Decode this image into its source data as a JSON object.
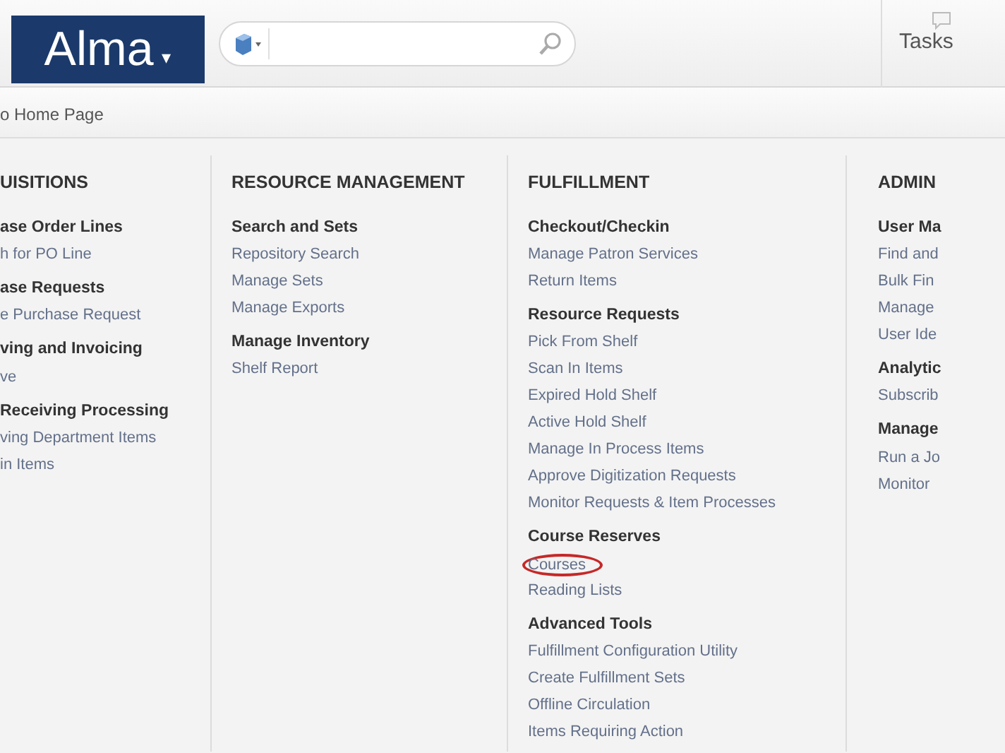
{
  "header": {
    "logo": "Alma",
    "logo_caret": "▾",
    "tasks": "Tasks"
  },
  "breadcrumb": "o Home Page",
  "columns": [
    {
      "title": "UISITIONS",
      "groups": [
        {
          "heading": "ase Order Lines",
          "items": [
            {
              "label": "h for PO Line",
              "highlighted": false
            }
          ]
        },
        {
          "heading": "ase Requests",
          "items": [
            {
              "label": "e Purchase Request",
              "highlighted": false
            }
          ]
        },
        {
          "heading": "ving and Invoicing",
          "items": [
            {
              "label": "ve",
              "highlighted": false
            }
          ]
        },
        {
          "heading": "Receiving Processing",
          "items": [
            {
              "label": "ving Department Items",
              "highlighted": false
            },
            {
              "label": "in Items",
              "highlighted": false
            }
          ]
        }
      ]
    },
    {
      "title": "RESOURCE MANAGEMENT",
      "groups": [
        {
          "heading": "Search and Sets",
          "items": [
            {
              "label": "Repository Search",
              "highlighted": false
            },
            {
              "label": "Manage Sets",
              "highlighted": false
            },
            {
              "label": "Manage Exports",
              "highlighted": false
            }
          ]
        },
        {
          "heading": "Manage Inventory",
          "items": [
            {
              "label": "Shelf Report",
              "highlighted": false
            }
          ]
        }
      ]
    },
    {
      "title": "FULFILLMENT",
      "groups": [
        {
          "heading": "Checkout/Checkin",
          "items": [
            {
              "label": "Manage Patron Services",
              "highlighted": false
            },
            {
              "label": "Return Items",
              "highlighted": false
            }
          ]
        },
        {
          "heading": "Resource Requests",
          "items": [
            {
              "label": "Pick From Shelf",
              "highlighted": false
            },
            {
              "label": "Scan In Items",
              "highlighted": false
            },
            {
              "label": "Expired Hold Shelf",
              "highlighted": false
            },
            {
              "label": "Active Hold Shelf",
              "highlighted": false
            },
            {
              "label": "Manage In Process Items",
              "highlighted": false
            },
            {
              "label": "Approve Digitization Requests",
              "highlighted": false
            },
            {
              "label": "Monitor Requests & Item Processes",
              "highlighted": false
            }
          ]
        },
        {
          "heading": "Course Reserves",
          "items": [
            {
              "label": "Courses",
              "highlighted": true
            },
            {
              "label": "Reading Lists",
              "highlighted": false
            }
          ]
        },
        {
          "heading": "Advanced Tools",
          "items": [
            {
              "label": "Fulfillment Configuration Utility",
              "highlighted": false
            },
            {
              "label": "Create Fulfillment Sets",
              "highlighted": false
            },
            {
              "label": "Offline Circulation",
              "highlighted": false
            },
            {
              "label": "Items Requiring Action",
              "highlighted": false
            }
          ]
        }
      ]
    },
    {
      "title": "ADMIN",
      "groups": [
        {
          "heading": "User Ma",
          "items": [
            {
              "label": "Find and",
              "highlighted": false
            },
            {
              "label": "Bulk Fin",
              "highlighted": false
            },
            {
              "label": "Manage",
              "highlighted": false
            },
            {
              "label": "User Ide",
              "highlighted": false
            }
          ]
        },
        {
          "heading": "Analytic",
          "items": [
            {
              "label": "Subscrib",
              "highlighted": false
            }
          ]
        },
        {
          "heading": "Manage",
          "items": [
            {
              "label": "Run a Jo",
              "highlighted": false
            },
            {
              "label": "Monitor",
              "highlighted": false
            }
          ]
        }
      ]
    }
  ]
}
